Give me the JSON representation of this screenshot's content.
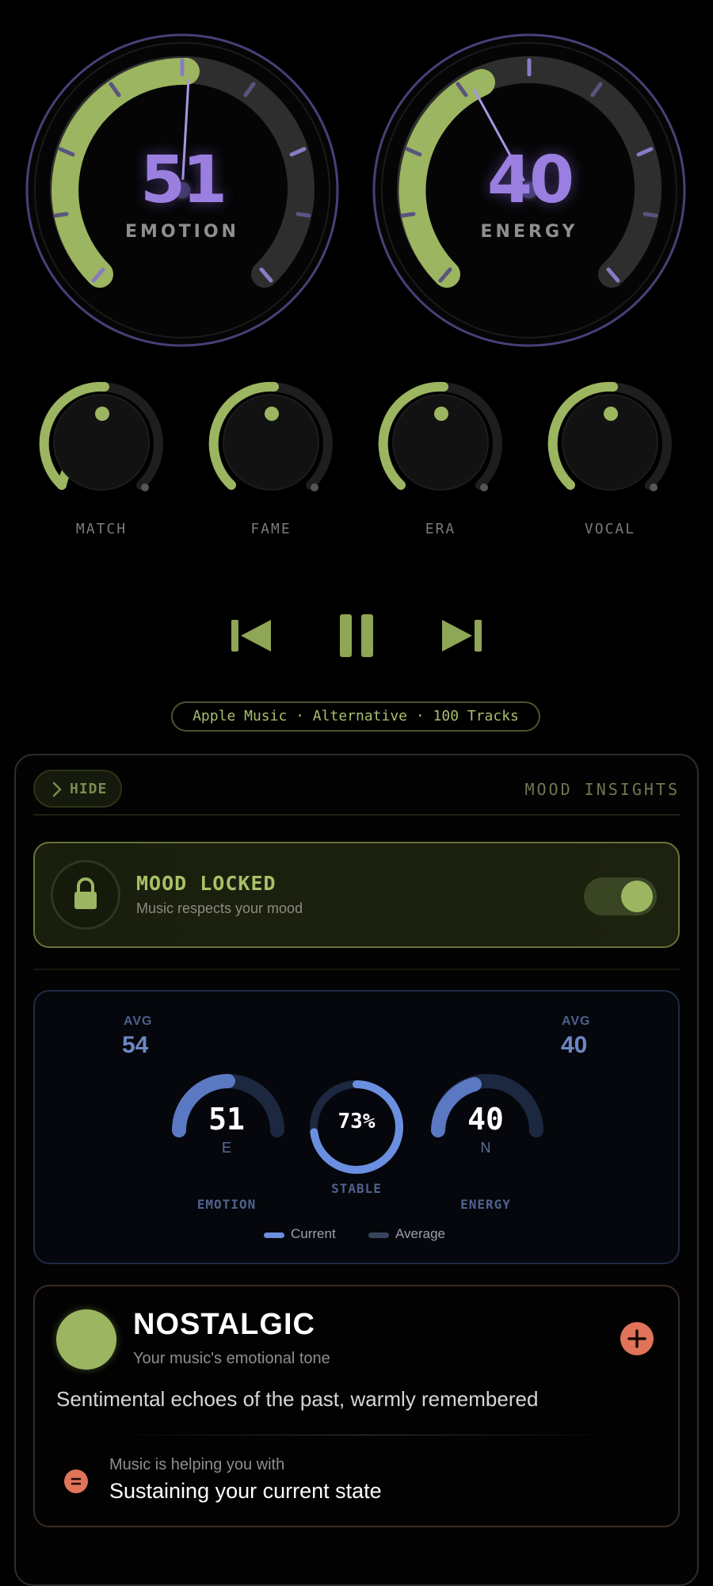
{
  "gauges": [
    {
      "label": "EMOTION",
      "value": "51",
      "level": 0.51
    },
    {
      "label": "ENERGY",
      "value": "40",
      "level": 0.4
    }
  ],
  "knobs": [
    {
      "label": "MATCH"
    },
    {
      "label": "FAME"
    },
    {
      "label": "ERA"
    },
    {
      "label": "VOCAL"
    }
  ],
  "transport": {
    "previous": "skip-back-icon",
    "pause": "pause-icon",
    "next": "skip-forward-icon"
  },
  "source": "Apple Music · Alternative · 100 Tracks",
  "insights": {
    "hide_label": "HIDE",
    "title": "MOOD INSIGHTS",
    "lock": {
      "title": "MOOD LOCKED",
      "subtitle": "Music respects your mood",
      "enabled": true
    },
    "stats": {
      "emotion": {
        "avg_label": "AVG",
        "avg": "54",
        "value": "51",
        "letter": "E",
        "caption": "EMOTION"
      },
      "energy": {
        "avg_label": "AVG",
        "avg": "40",
        "value": "40",
        "letter": "N",
        "caption": "ENERGY"
      },
      "stability": {
        "value": "73%",
        "label": "STABLE",
        "level": 0.73
      },
      "legend": {
        "current": "Current",
        "average": "Average"
      }
    },
    "mood": {
      "name": "NOSTALGIC",
      "subtitle": "Your music's emotional tone",
      "description": "Sentimental echoes of the past, warmly remembered",
      "help_label": "Music is helping you with",
      "help_value": "Sustaining your current state"
    }
  },
  "colors": {
    "accent_green": "#9cb560",
    "accent_purple": "#9a7fe0",
    "accent_blue": "#6d88c4",
    "accent_orange": "#e0735a"
  }
}
